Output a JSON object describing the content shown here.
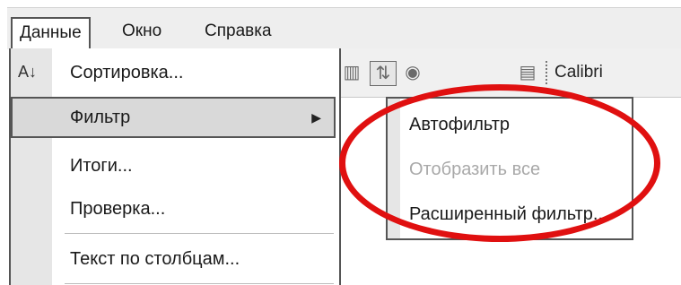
{
  "menubar": {
    "items": [
      {
        "label": "Данные",
        "active": true
      },
      {
        "label": "Окно",
        "active": false
      },
      {
        "label": "Справка",
        "active": false
      }
    ]
  },
  "toolbar": {
    "icons": [
      "chart-icon",
      "sort-icon",
      "help-icon",
      "paint-icon"
    ],
    "font_name": "Calibri"
  },
  "data_menu": {
    "items": [
      {
        "label": "Сортировка...",
        "icon": "sort-az-icon"
      },
      {
        "label": "Фильтр",
        "has_submenu": true,
        "highlighted": true
      },
      {
        "label": "Итоги..."
      },
      {
        "label": "Проверка..."
      },
      {
        "label": "Текст по столбцам..."
      }
    ]
  },
  "filter_submenu": {
    "items": [
      {
        "label": "Автофильтр",
        "enabled": true
      },
      {
        "label": "Отобразить все",
        "enabled": false
      },
      {
        "label": "Расширенный фильтр...",
        "enabled": true
      }
    ]
  },
  "annotation": {
    "color": "#e01010"
  }
}
